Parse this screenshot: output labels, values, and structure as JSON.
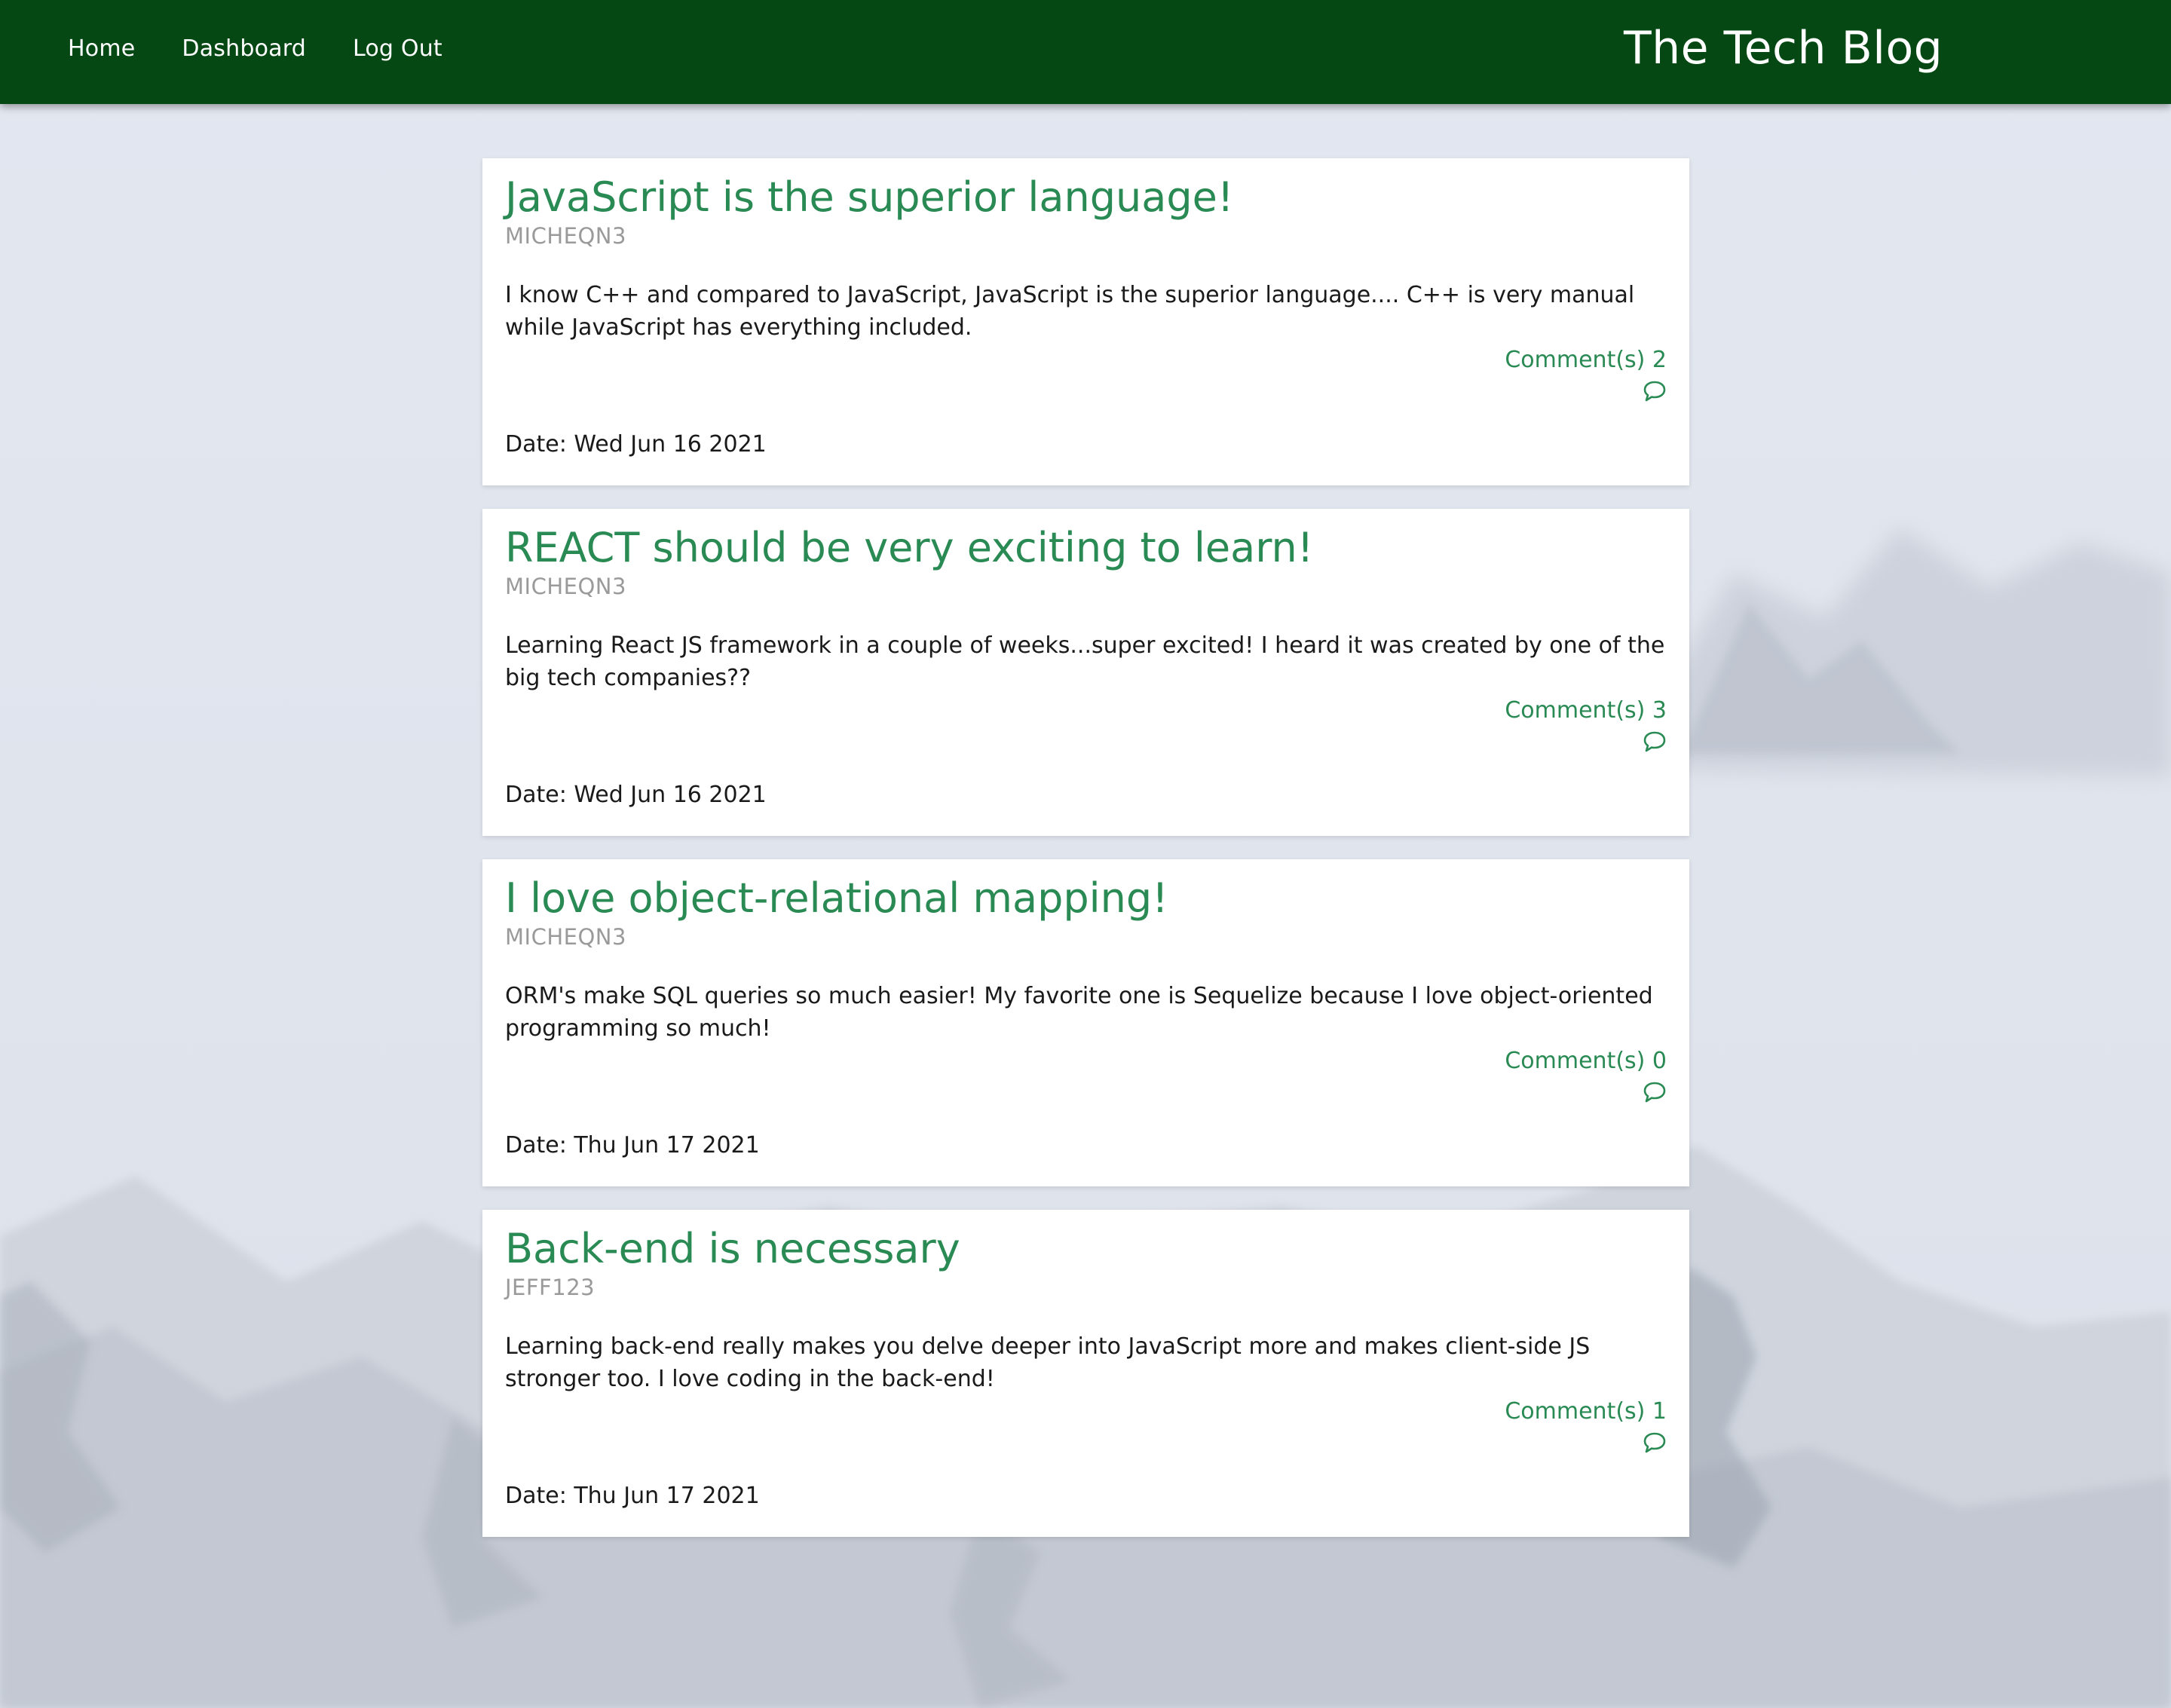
{
  "nav": {
    "links": [
      "Home",
      "Dashboard",
      "Log Out"
    ],
    "brand": "The Tech Blog"
  },
  "posts": [
    {
      "title": "JavaScript is the superior language!",
      "author": "MICHEQN3",
      "body": "I know C++ and compared to JavaScript, JavaScript is the superior language.... C++ is very manual while JavaScript has everything included.",
      "comments": "Comment(s) 2",
      "date": "Date: Wed Jun 16 2021"
    },
    {
      "title": "REACT should be very exciting to learn!",
      "author": "MICHEQN3",
      "body": "Learning React JS framework in a couple of weeks...super excited! I heard it was created by one of the big tech companies??",
      "comments": "Comment(s) 3",
      "date": "Date: Wed Jun 16 2021"
    },
    {
      "title": "I love object-relational mapping!",
      "author": "MICHEQN3",
      "body": "ORM's make SQL queries so much easier! My favorite one is Sequelize because I love object-oriented programming so much!",
      "comments": "Comment(s) 0",
      "date": "Date: Thu Jun 17 2021"
    },
    {
      "title": "Back-end is necessary",
      "author": "JEFF123",
      "body": "Learning back-end really makes you delve deeper into JavaScript more and makes client-side JS stronger too. I love coding in the back-end!",
      "comments": "Comment(s) 1",
      "date": "Date: Thu Jun 17 2021"
    }
  ],
  "colors": {
    "navbar": "#064813",
    "accent": "#2a8a54",
    "author": "#9a9a9a",
    "background": "#e2e6ef"
  },
  "icons": {
    "comment": "speech-bubble-icon"
  }
}
